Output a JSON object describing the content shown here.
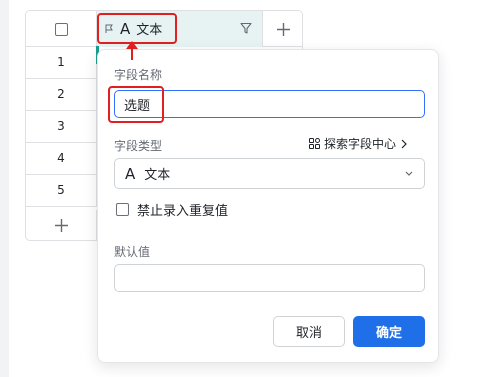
{
  "grid": {
    "row_numbers": [
      "1",
      "2",
      "3",
      "4",
      "5"
    ],
    "field_header": {
      "name": "文本",
      "type_glyph": "A"
    }
  },
  "popover": {
    "field_name_label": "字段名称",
    "field_name_value": "选题",
    "field_type_label": "字段类型",
    "explore_link": "探索字段中心",
    "field_type_value": "文本",
    "field_type_glyph": "A",
    "forbid_duplicate_label": "禁止录入重复值",
    "forbid_duplicate_checked": false,
    "default_value_label": "默认值",
    "default_value": "",
    "cancel_label": "取消",
    "ok_label": "确定"
  },
  "colors": {
    "primary": "#1e6fe8",
    "focus_border": "#3370ff",
    "annotation_red": "#e02020",
    "header_highlight": "#e6f3f2"
  },
  "icons": [
    "checkbox-icon",
    "flag-icon",
    "text-type-icon",
    "filter-icon",
    "plus-icon",
    "grid-icon",
    "chevron-right-icon",
    "chevron-down-icon",
    "red-arrow-icon"
  ]
}
